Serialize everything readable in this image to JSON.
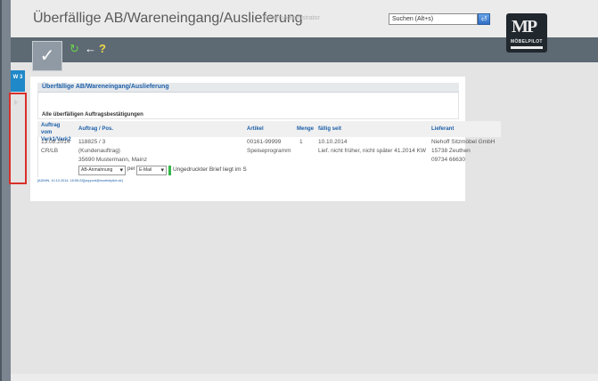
{
  "header": {
    "title": "Überfällige AB/Wareneingang/Auslieferung",
    "user": "Systemadministrator",
    "search_placeholder": "Suchen (Alt+s)",
    "logo_text": "MP",
    "logo_sub": "MÖBELPILOT"
  },
  "toolbar": {
    "confirm_label": "✓",
    "refresh_icon": "↻",
    "back_icon": "←",
    "help_icon": "?"
  },
  "side_tab": {
    "label": "W 3"
  },
  "section": {
    "title": "Überfällige AB/Wareneingang/Auslieferung",
    "list_caption": "Alle überfälligen Auftragsbestätigungen"
  },
  "table": {
    "columns": [
      "Auftrag vom Verk1/Verk2",
      "Auftrag / Pos.",
      "Artikel",
      "Menge",
      "fällig seit",
      "Lieferant"
    ],
    "row": {
      "date": "13.08.2014",
      "verk": "CR/LB",
      "auftrag": "118825 / 3",
      "auftrag_type": "(Kundenauftrag)",
      "customer": "35690 Mustermann, Mainz",
      "artikel": "00161-99999",
      "artikel_name": "Speiseprogramm",
      "menge": "1",
      "faellig": "10.10.2014",
      "lieferung": "Lief. nicht früher, nicht später 41.2014 KW",
      "lieferant": "Niehoff Sitzmöbel GmbH",
      "lieferant_ort": "15738 Zeuthen",
      "lieferant_tel": "09734 66630"
    },
    "action": {
      "type_value": "AB-Anmahnung",
      "per_label": "per",
      "channel_value": "E-Mail",
      "note": "Ungedruckter Brief liegt im S"
    },
    "meta": "[ADMIN, 10.10.2014, 18:55:22][support@moebelpilot.de]"
  }
}
